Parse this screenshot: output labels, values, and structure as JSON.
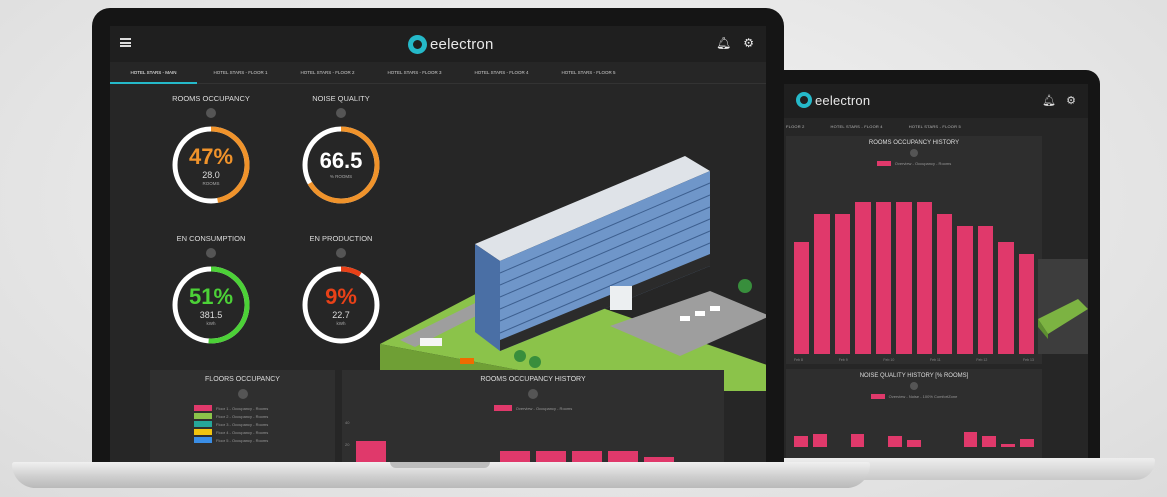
{
  "app": {
    "logo_text": "eelectron"
  },
  "colors": {
    "accent": "#25b9c9",
    "orange": "#f0932b",
    "green": "#4cd137",
    "red": "#e84118",
    "pink": "#e0396b"
  },
  "front": {
    "tabs": [
      {
        "label": "HOTEL STARS - MAIN",
        "active": true
      },
      {
        "label": "HOTEL STARS - FLOOR 1"
      },
      {
        "label": "HOTEL STARS - FLOOR 2"
      },
      {
        "label": "HOTEL STARS - FLOOR 3"
      },
      {
        "label": "HOTEL STARS - FLOOR 4"
      },
      {
        "label": "HOTEL STARS - FLOOR 5"
      }
    ],
    "gauges": {
      "occupancy": {
        "title": "ROOMS OCCUPANCY",
        "value": "47%",
        "sub": "28.0",
        "unit": "ROOMS",
        "level": 0.47,
        "color": "#f0932b"
      },
      "noise": {
        "title": "NOISE QUALITY",
        "value": "66.5",
        "sub": "",
        "unit": "% ROOMS",
        "level": 0.665,
        "color": "#f0932b"
      },
      "consumption": {
        "title": "EN CONSUMPTION",
        "value": "51%",
        "sub": "381.5",
        "unit": "kWh",
        "level": 0.51,
        "color": "#4cd137"
      },
      "production": {
        "title": "EN PRODUCTION",
        "value": "9%",
        "sub": "22.7",
        "unit": "kWh",
        "level": 0.09,
        "color": "#e84118"
      }
    },
    "floors_panel": {
      "title": "FLOORS OCCUPANCY",
      "legend": [
        {
          "label": "Floor 1 - Occupancy - Rooms",
          "color": "#e0396b"
        },
        {
          "label": "Floor 2 - Occupancy - Rooms",
          "color": "#8bc34a"
        },
        {
          "label": "Floor 3 - Occupancy - Rooms",
          "color": "#26a69a"
        },
        {
          "label": "Floor 4 - Occupancy - Rooms",
          "color": "#f1c40f"
        },
        {
          "label": "Floor 5 - Occupancy - Rooms",
          "color": "#3a8ee6"
        }
      ]
    },
    "history_panel": {
      "title": "ROOMS OCCUPANCY HISTORY",
      "legend": "Overview - Occupancy - Rooms",
      "y_ticks": [
        "40",
        "20"
      ],
      "values": [
        22,
        1,
        1,
        1,
        14,
        14,
        14,
        14,
        10,
        1
      ]
    }
  },
  "back": {
    "tabs": [
      "FLOOR 2",
      "HOTEL STARS - FLOOR 4",
      "HOTEL STARS - FLOOR 5"
    ],
    "history_panel": {
      "title": "ROOMS OCCUPANCY HISTORY",
      "legend": "Overview - Occupancy - Rooms",
      "values": [
        140,
        175,
        175,
        190,
        190,
        190,
        190,
        175,
        160,
        160,
        140,
        125
      ],
      "x_labels": [
        "Feb 8",
        "Feb 9",
        "Feb 10",
        "Feb 11",
        "Feb 12",
        "Feb 13"
      ]
    },
    "noise_panel": {
      "title": "NOISE QUALITY HISTORY [% ROOMS]",
      "legend": "Overview - Noise - 100% ComfortZone",
      "values": [
        10,
        12,
        0,
        12,
        0,
        10,
        6,
        0,
        0,
        14,
        10,
        3,
        7
      ]
    }
  }
}
